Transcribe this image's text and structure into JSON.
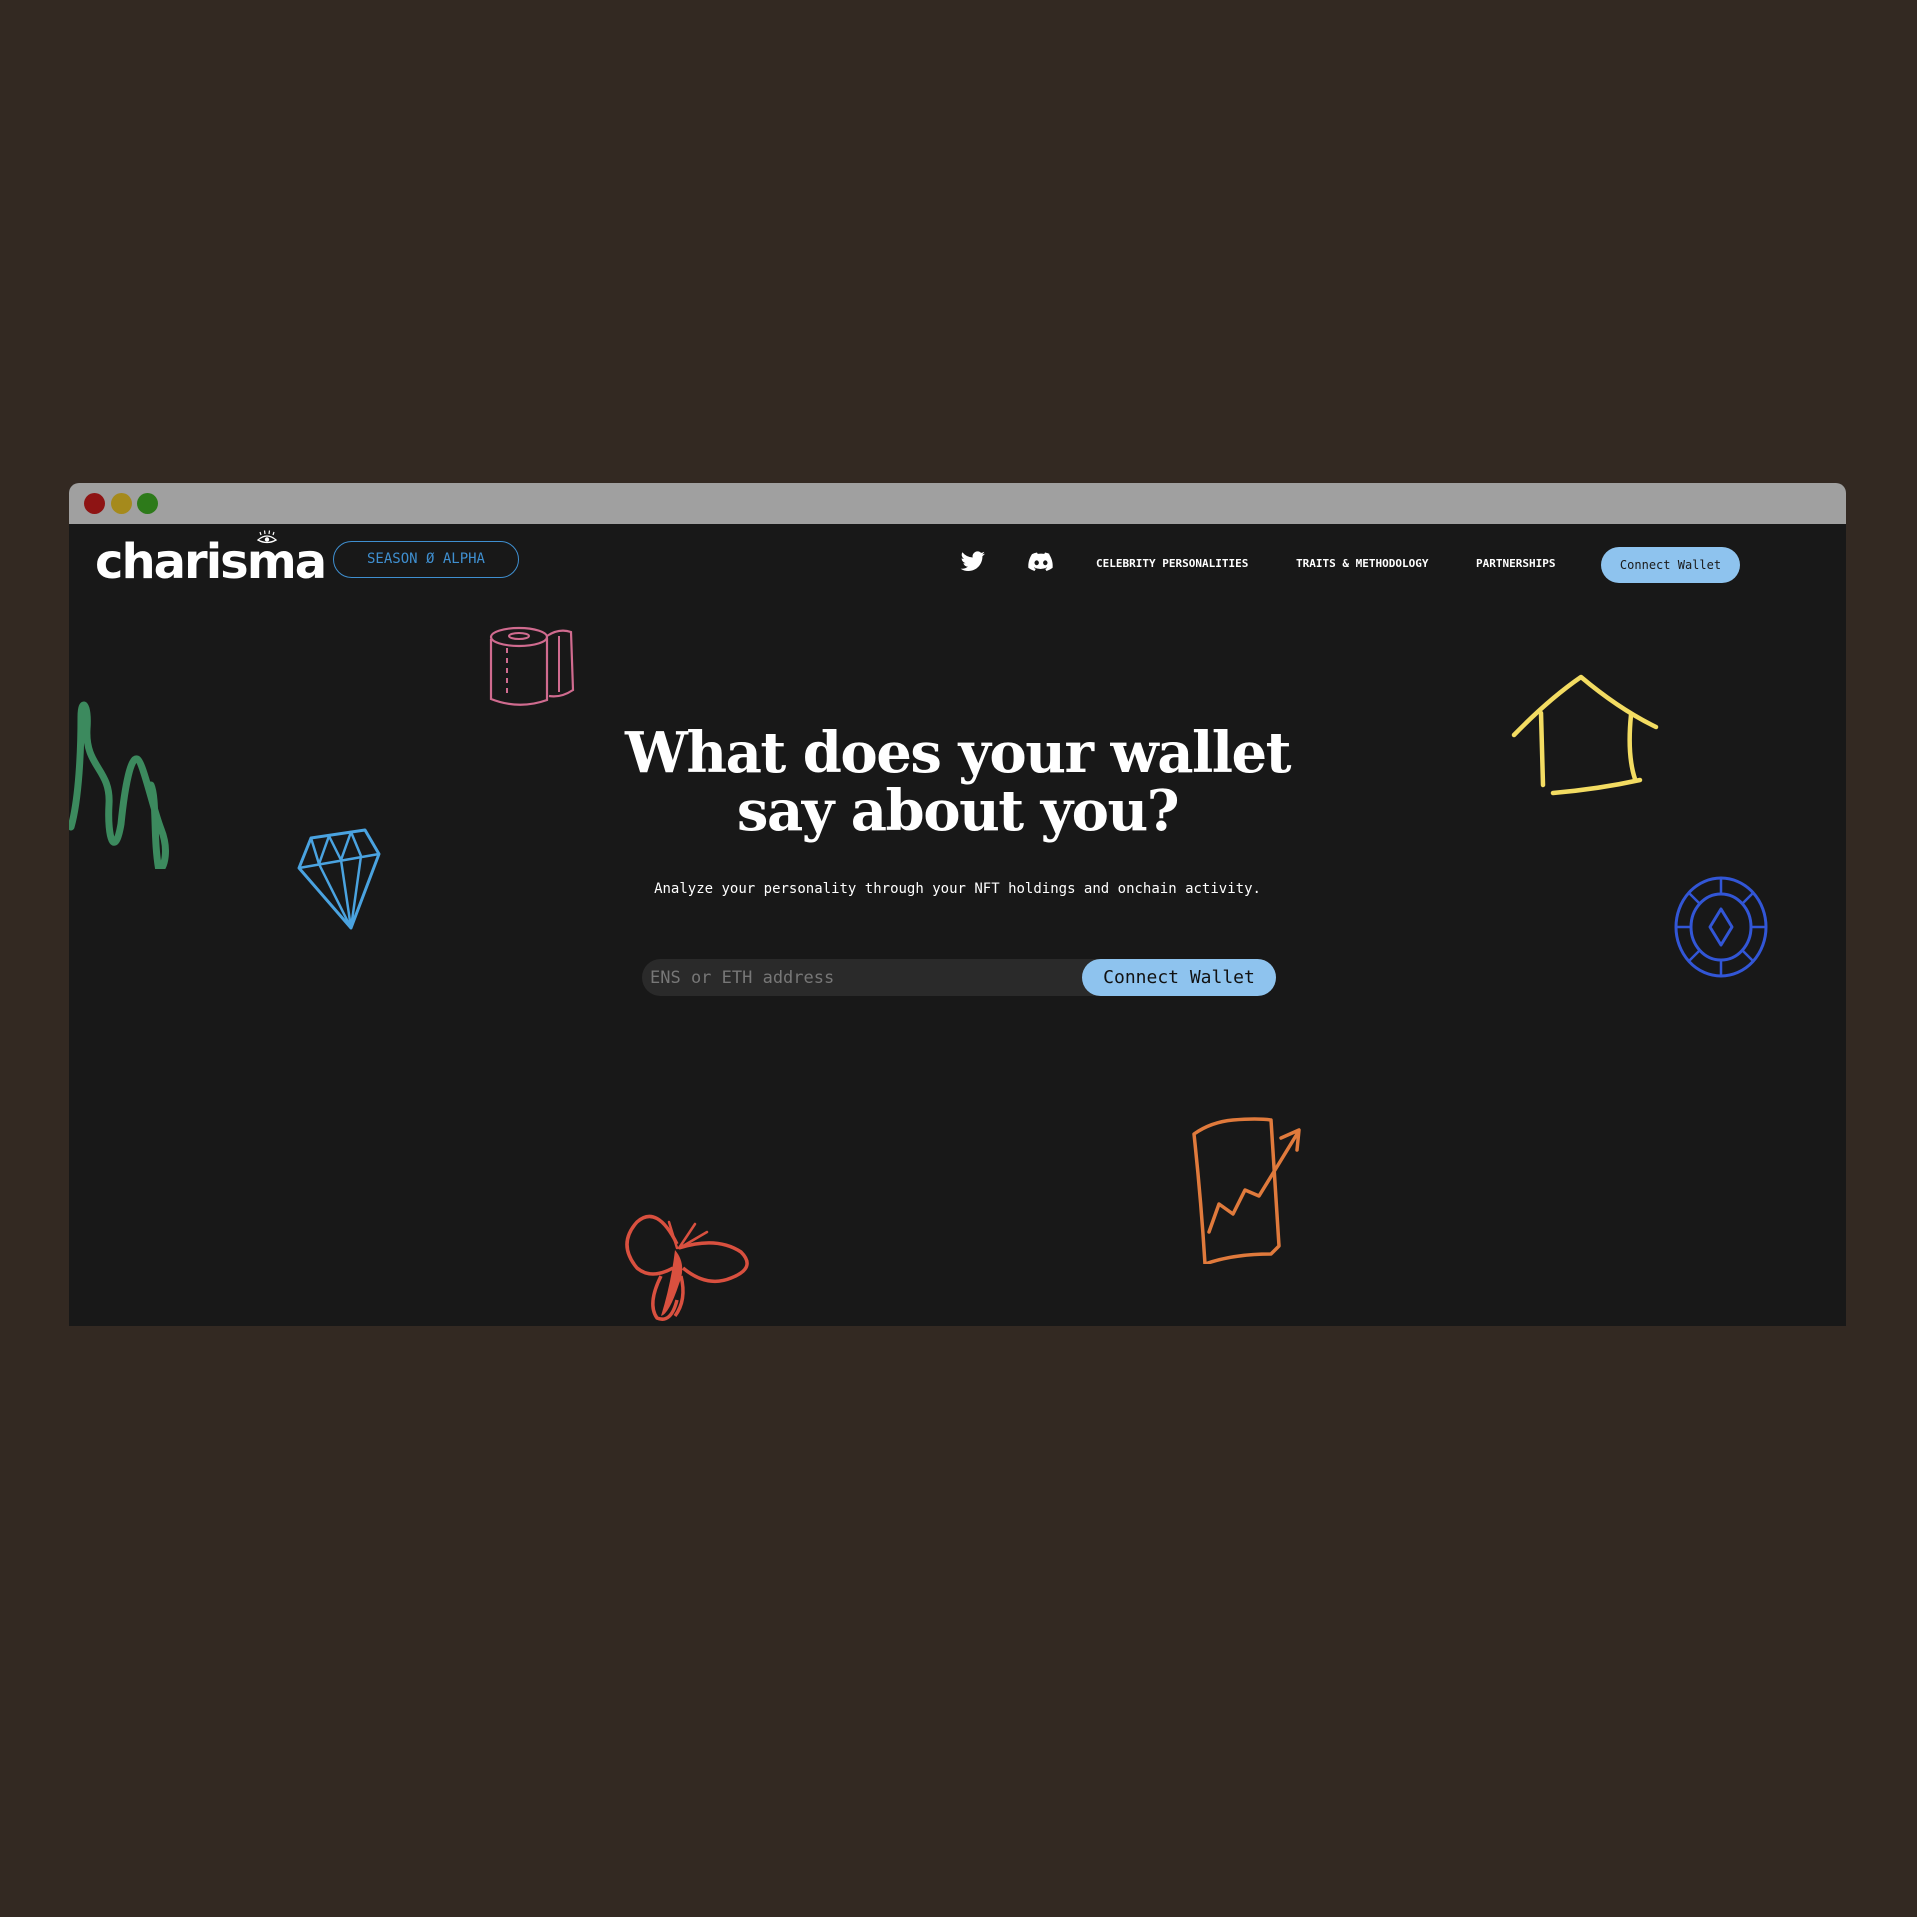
{
  "brand": {
    "logo": "charisma",
    "season_badge": "SEASON Ø ALPHA"
  },
  "nav": {
    "icons": [
      "twitter-icon",
      "discord-icon"
    ],
    "links": [
      "CELEBRITY PERSONALITIES",
      "TRAITS & METHODOLOGY",
      "PARTNERSHIPS"
    ],
    "cta": "Connect Wallet"
  },
  "hero": {
    "title_line1": "What does your wallet",
    "title_line2": "say about you?",
    "subtitle": "Analyze your personality through your NFT holdings and onchain activity.",
    "search_placeholder": "ENS or ETH address",
    "search_button": "Connect Wallet"
  },
  "decorations": [
    "scribble",
    "toilet-paper-icon",
    "house-icon",
    "diamond-icon",
    "coin-icon",
    "chart-document-icon",
    "butterfly-icon"
  ],
  "colors": {
    "background": "#181818",
    "accent": "#8ec3ee",
    "badge": "#3f8fd0",
    "window_chrome": "#a0a0a0",
    "backdrop": "#332922"
  }
}
